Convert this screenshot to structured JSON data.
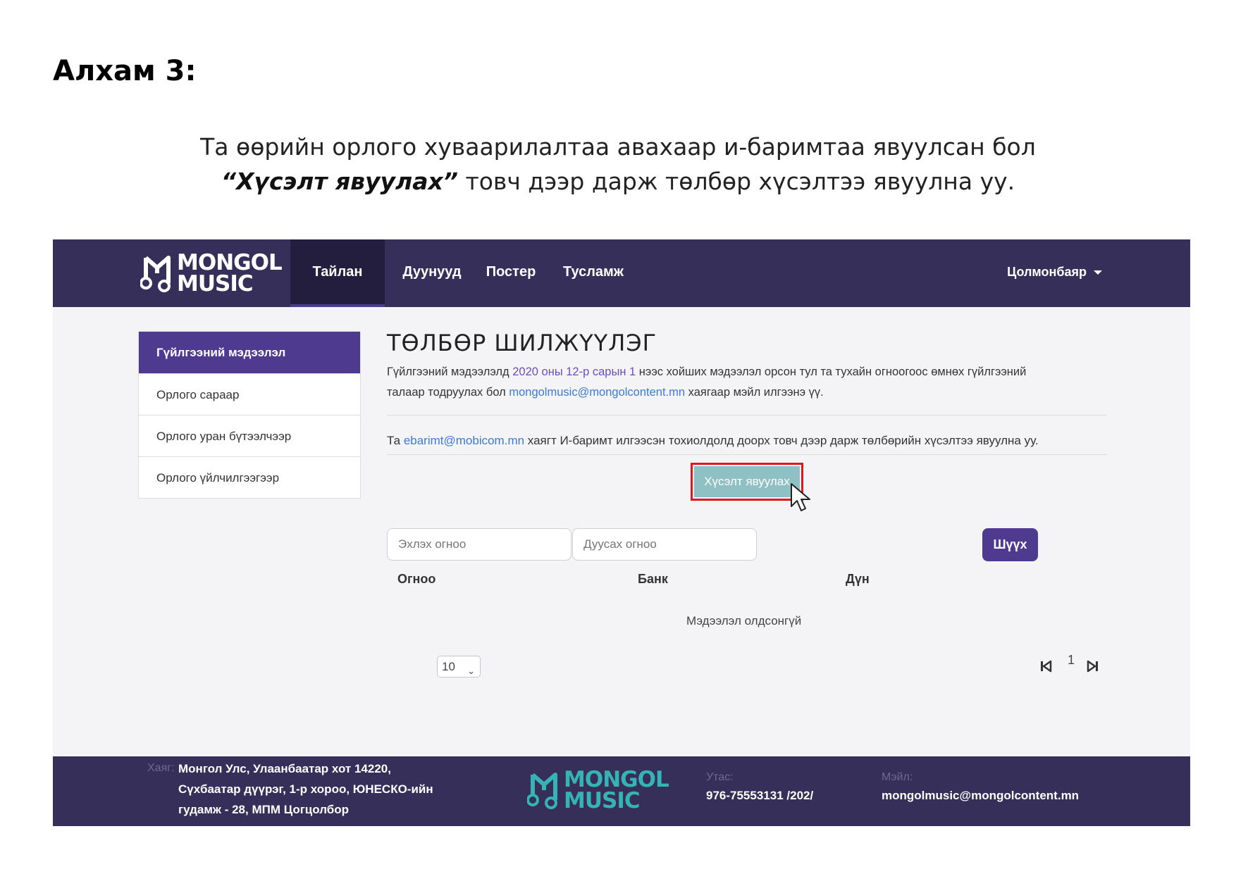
{
  "step_title": "Алхам 3:",
  "instruction": {
    "line1": "Та өөрийн орлого хуваарилалтаа авахаар и-баримтаа явуулсан бол",
    "line2_em": "“Хүсэлт явуулах”",
    "line2_rest": " товч дээр дарж төлбөр хүсэлтээ явуулна уу."
  },
  "header": {
    "logo_line1": "MONGOL",
    "logo_line2": "MUSIC",
    "nav": [
      "Тайлан",
      "Дуунууд",
      "Постер",
      "Тусламж"
    ],
    "active_nav": "Тайлан",
    "user": "Цолмонбаяр"
  },
  "sidebar": {
    "items": [
      "Гүйлгээний мэдээлэл",
      "Орлого сараар",
      "Орлого уран бүтээлчээр",
      "Орлого үйлчилгээгээр"
    ]
  },
  "main": {
    "title": "ТӨЛБӨР ШИЛЖҮҮЛЭГ",
    "info_a": "Гүйлгээний мэдээлэлд ",
    "info_date": "2020 оны 12-р сарын 1",
    "info_b": " нээс хойших мэдээлэл орсон тул та тухайн огноогоос өмнөх гүйлгээний",
    "info_c": "талаар тодруулах бол ",
    "info_email": "mongolmusic@mongolcontent.mn",
    "info_d": " хаягаар мэйл илгээнэ үү.",
    "note_a": "Та ",
    "note_email": "ebarimt@mobicom.mn",
    "note_b": " хаягт И-баримт илгээсэн тохиолдолд доорх товч дээр дарж төлбөрийн хүсэлтээ явуулна уу.",
    "request_button": "Хүсэлт явуулах",
    "start_date_placeholder": "Эхлэх огноо",
    "end_date_placeholder": "Дуусах огноо",
    "search_button": "Шүүх",
    "columns": [
      "Огноо",
      "Банк",
      "Дүн"
    ],
    "empty_text": "Мэдээлэл олдсонгүй",
    "page_size": "10",
    "page_number": "1"
  },
  "footer": {
    "address_label": "Хаяг:",
    "address_lines": [
      "Монгол Улс, Улаанбаатар хот 14220,",
      "Сүхбаатар дүүрэг, 1-р хороо, ЮНЕСКО-ийн",
      "гудамж - 28, МПМ Цогцолбор"
    ],
    "phone_label": "Утас:",
    "phone": "976-75553131 /202/",
    "email_label": "Мэйл:",
    "email": "mongolmusic@mongolcontent.mn"
  },
  "colors": {
    "header_bg": "#352f59",
    "accent_purple": "#4e3a8e",
    "request_button": "#8fc0c4",
    "highlight_red": "#e0191f",
    "logo_teal": "#35b3b5"
  },
  "icons": [
    "music-note-logo-icon",
    "caret-down-icon",
    "cursor-pointer-icon",
    "chevron-down-icon",
    "first-page-icon",
    "last-page-icon"
  ]
}
